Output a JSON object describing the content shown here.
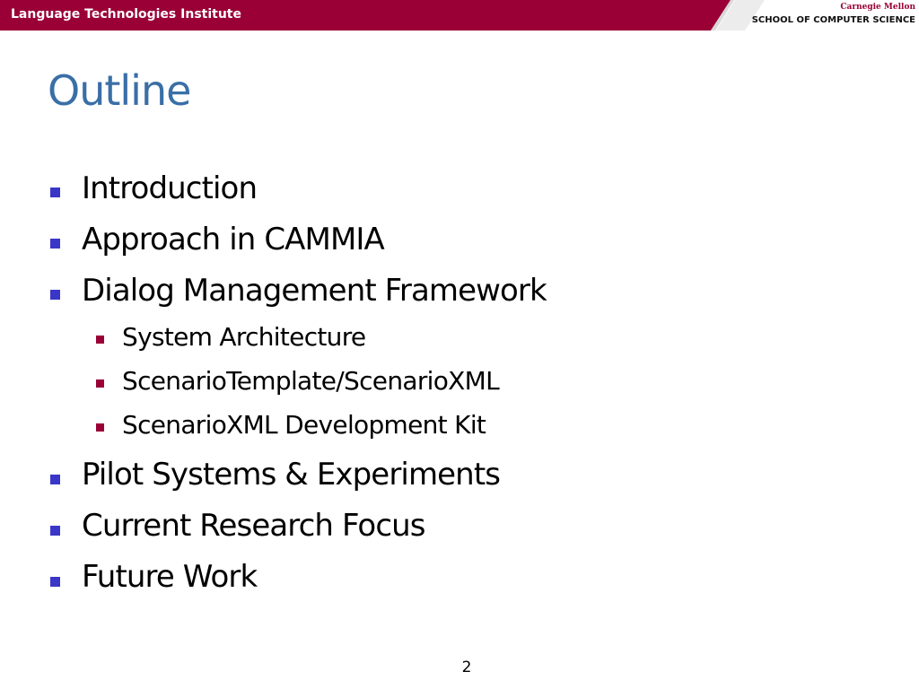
{
  "header": {
    "institute": "Language Technologies Institute",
    "university": "Carnegie Mellon",
    "school": "SCHOOL OF COMPUTER SCIENCE"
  },
  "slide": {
    "title": "Outline",
    "items": [
      {
        "label": "Introduction",
        "level": 1
      },
      {
        "label": "Approach in CAMMIA",
        "level": 1
      },
      {
        "label": "Dialog Management Framework",
        "level": 1
      },
      {
        "label": "System Architecture",
        "level": 2
      },
      {
        "label": "ScenarioTemplate/ScenarioXML",
        "level": 2
      },
      {
        "label": "ScenarioXML Development Kit",
        "level": 2
      },
      {
        "label": "Pilot Systems & Experiments",
        "level": 1
      },
      {
        "label": "Current Research Focus",
        "level": 1
      },
      {
        "label": "Future Work",
        "level": 1
      }
    ],
    "page_number": "2"
  },
  "colors": {
    "header_bar": "#9a0036",
    "title": "#3a6fa6",
    "bullet_level1": "#3a36c8",
    "bullet_level2": "#9a0036",
    "text": "#000000"
  }
}
